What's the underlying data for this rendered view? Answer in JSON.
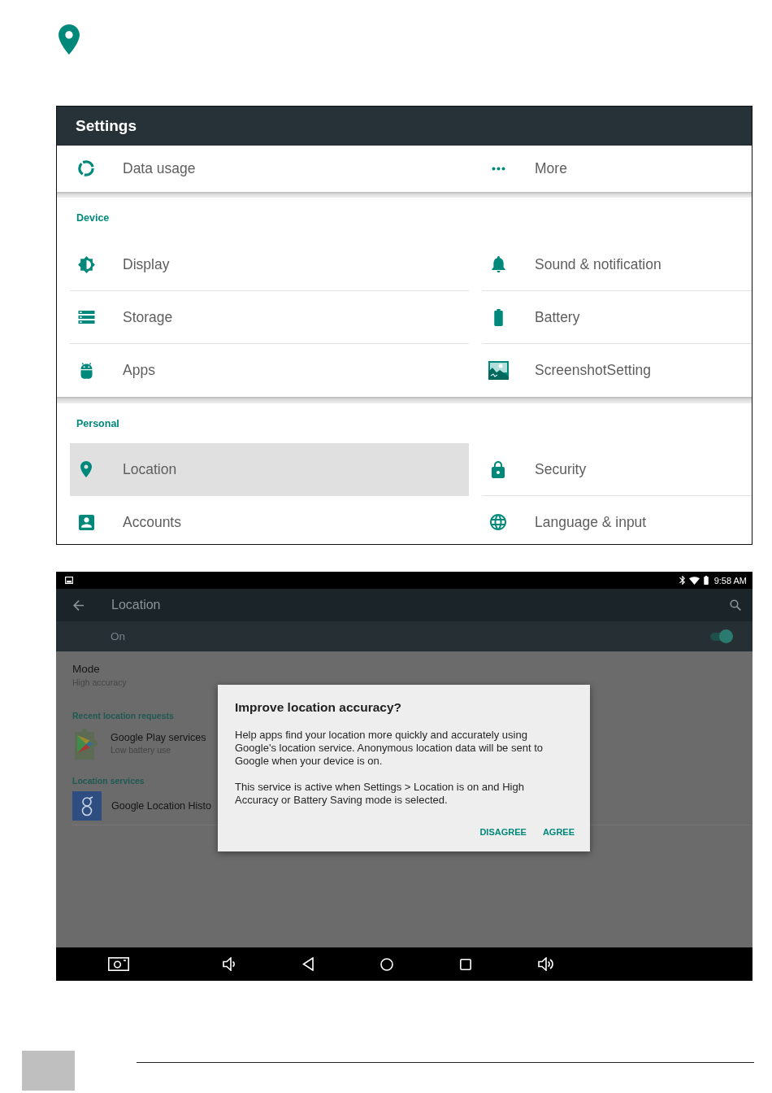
{
  "settings_screen": {
    "title": "Settings",
    "top_items": [
      {
        "label": "Data usage",
        "selected": false
      },
      {
        "label": "More",
        "selected": false
      }
    ],
    "sections": [
      {
        "title": "Device",
        "items": [
          {
            "label": "Display",
            "selected": false
          },
          {
            "label": "Sound & notification",
            "selected": false
          },
          {
            "label": "Storage",
            "selected": false
          },
          {
            "label": "Battery",
            "selected": false
          },
          {
            "label": "Apps",
            "selected": false
          },
          {
            "label": "ScreenshotSetting",
            "selected": false
          }
        ]
      },
      {
        "title": "Personal",
        "items": [
          {
            "label": "Location",
            "selected": true
          },
          {
            "label": "Security",
            "selected": false
          },
          {
            "label": "Accounts",
            "selected": false
          },
          {
            "label": "Language & input",
            "selected": false
          }
        ]
      }
    ]
  },
  "location_screen": {
    "status_bar": {
      "time": "9:58 AM"
    },
    "toolbar": {
      "title": "Location"
    },
    "master_switch": {
      "label": "On",
      "on": true
    },
    "mode": {
      "title": "Mode",
      "value": "High accuracy"
    },
    "recent_requests": {
      "title": "Recent location requests",
      "apps": [
        {
          "name": "Google Play services",
          "detail": "Low battery use"
        }
      ]
    },
    "location_services": {
      "title": "Location services",
      "items": [
        {
          "name": "Google Location Histo"
        }
      ]
    },
    "dialog": {
      "title": "Improve location accuracy?",
      "paragraphs": [
        "Help apps find your location more quickly and accurately using Google's location service. Anonymous location data will be sent to Google when your device is on.",
        "This service is active when Settings > Location is on and High Accuracy or Battery Saving mode is selected."
      ],
      "buttons": [
        "DISAGREE",
        "AGREE"
      ]
    }
  }
}
